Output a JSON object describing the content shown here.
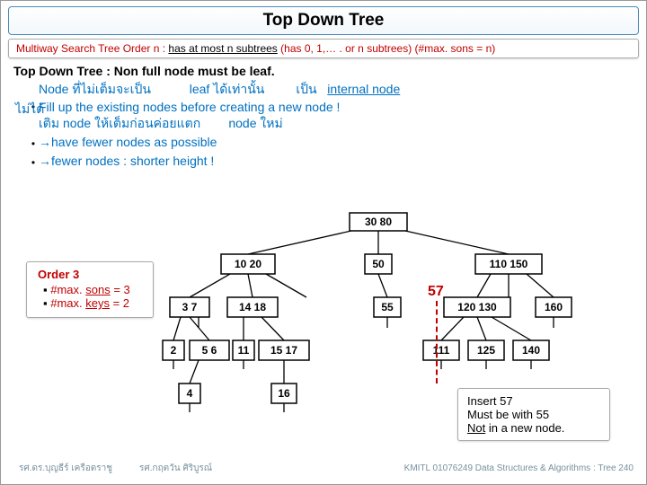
{
  "title": "Top Down Tree",
  "subtitle": {
    "lead": "Multiway Search Tree Order n :  ",
    "underlined": "has at most n subtrees",
    "tail": " (has 0, 1,… . or n subtrees) (#max. sons = n)"
  },
  "rule_line": "Top Down Tree : Non full node must be leaf.",
  "bullets": {
    "b1_line1_a": "Node ที่ไม่เต็มจะเป็น",
    "b1_line1_b": "leaf ได้เท่านั้น",
    "b1_line1_c": "เป็น",
    "b1_line1_d": "internal node",
    "b1_line2_pre": "ไม่ได้",
    "b1_line2_main": "Fill up the existing nodes before creating a new node !",
    "b1_line3_a": "เติม   node ให้เต็มก่อนค่อยแตก",
    "b1_line3_b": "node ใหม่",
    "b2": "→have fewer nodes as possible",
    "b3": "→fewer nodes : shorter height !"
  },
  "orderbox": {
    "heading": "Order 3",
    "li1_label": "#max. ",
    "li1_u": "sons",
    "li1_tail": " = 3",
    "li2_label": "#max. ",
    "li2_u": "keys",
    "li2_tail": " = 2"
  },
  "insertbox": {
    "l1": "Insert   57",
    "l2": "Must be with 55",
    "l3_a": "Not",
    "l3_b": "  in a new node."
  },
  "new_val": "57",
  "tree": {
    "root": "30   80",
    "l1": [
      "10   20",
      "50",
      "110   150"
    ],
    "l2": [
      "3   7",
      "14   18",
      "55",
      "120   130",
      "160"
    ],
    "l3_left": [
      "2",
      "5   6",
      "11",
      "15   17"
    ],
    "l3_left2": [
      "111",
      "125",
      "140"
    ],
    "l4": [
      "4",
      "16"
    ]
  },
  "footer": {
    "left": "รศ.ดร.บุญธีร์     เครือตราชู",
    "center": "รศ.กฤตวัน   ศิริบูรณ์",
    "right": "KMITL   01076249 Data Structures & Algorithms : Tree 240"
  }
}
